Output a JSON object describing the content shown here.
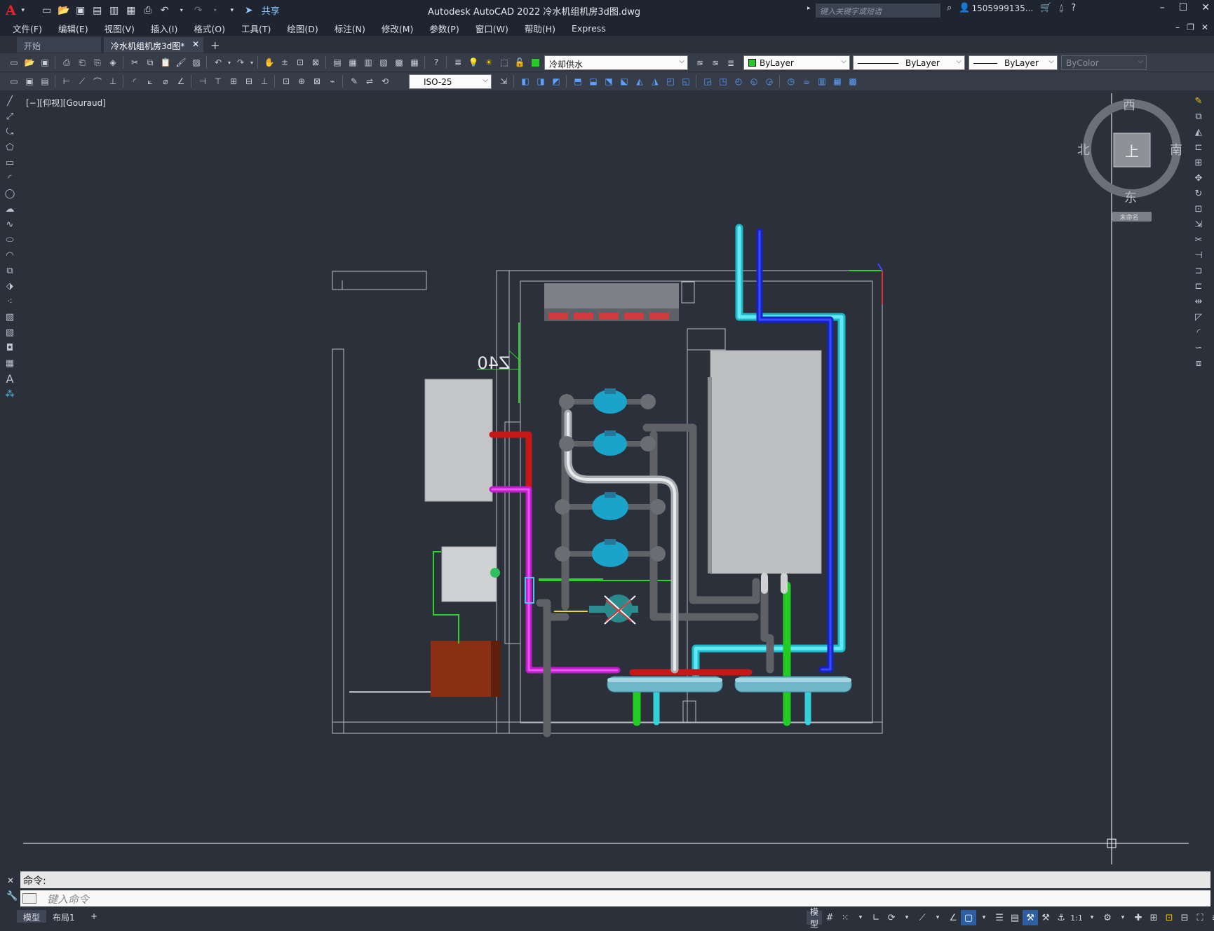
{
  "app": {
    "logo": "A",
    "window_title": "Autodesk AutoCAD 2022    冷水机组机房3d图.dwg",
    "share_label": "共享",
    "search_placeholder": "键入关键字或短语",
    "user": "1505999135...",
    "window_controls": [
      "–",
      "☐",
      "✕"
    ]
  },
  "menu": {
    "items": [
      "文件(F)",
      "编辑(E)",
      "视图(V)",
      "插入(I)",
      "格式(O)",
      "工具(T)",
      "绘图(D)",
      "标注(N)",
      "修改(M)",
      "参数(P)",
      "窗口(W)",
      "帮助(H)",
      "Express"
    ]
  },
  "tabs": {
    "start": "开始",
    "document": "冷水机组机房3d图*",
    "close": "✕",
    "add": "+"
  },
  "toolbar": {
    "layer": "冷却供水",
    "color": "ByLayer",
    "linetype": "ByLayer",
    "lineweight": "ByLayer",
    "plotstyle": "ByColor",
    "dimstyle": "ISO-25"
  },
  "viewport": {
    "label": "[−][仰视][Gouraud]",
    "dim_text": "Z40"
  },
  "viewcube": {
    "top": "西",
    "left": "北",
    "right": "南",
    "bottom": "东",
    "face": "上",
    "wcs": "未命名"
  },
  "command": {
    "history": "命令:",
    "placeholder": "键入命令"
  },
  "status": {
    "layouts": [
      "模型",
      "布局1"
    ],
    "add": "+",
    "model_label": "模型",
    "scale": "1:1"
  }
}
